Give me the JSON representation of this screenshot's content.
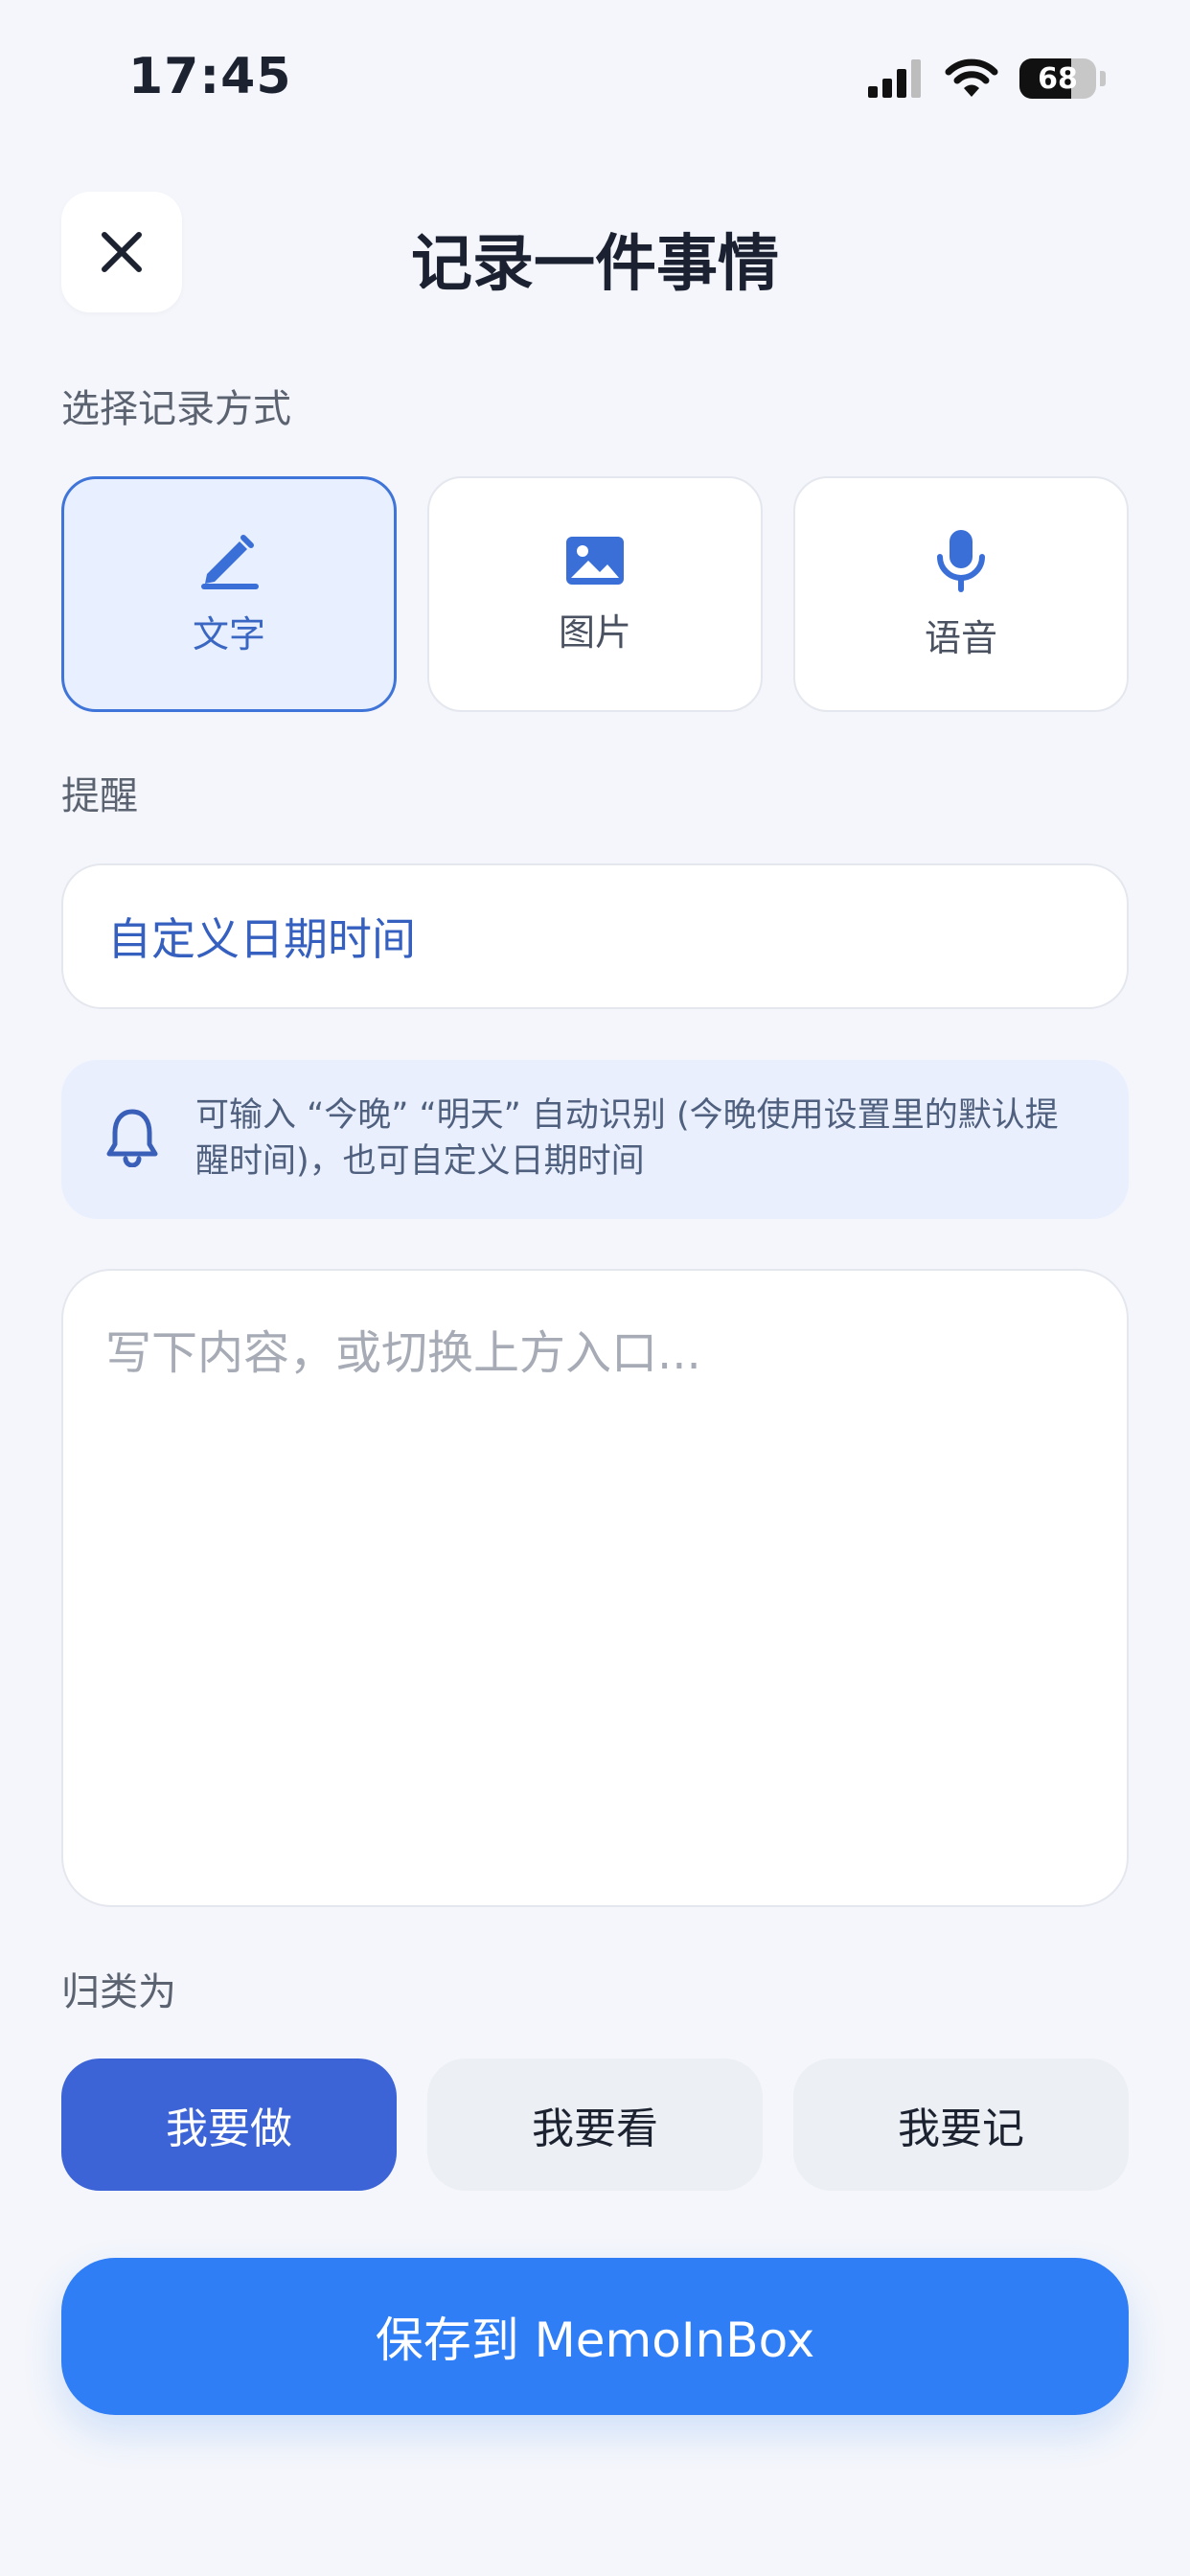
{
  "status_bar": {
    "time": "17:45",
    "battery_level": "68",
    "battery_fraction": 0.68
  },
  "header": {
    "title": "记录一件事情",
    "close_icon": "close-icon"
  },
  "mode_section": {
    "label": "选择记录方式",
    "options": [
      {
        "label": "文字",
        "icon": "pencil-icon",
        "selected": true
      },
      {
        "label": "图片",
        "icon": "image-icon",
        "selected": false
      },
      {
        "label": "语音",
        "icon": "microphone-icon",
        "selected": false
      }
    ]
  },
  "reminder": {
    "label": "提醒",
    "value": "自定义日期时间",
    "hint": "可输入 “今晚” “明天” 自动识别 (今晚使用设置里的默认提醒时间)，也可自定义日期时间",
    "hint_icon": "bell-icon"
  },
  "content": {
    "placeholder": "写下内容，或切换上方入口..."
  },
  "category": {
    "label": "归类为",
    "options": [
      {
        "label": "我要做",
        "selected": true
      },
      {
        "label": "我要看",
        "selected": false
      },
      {
        "label": "我要记",
        "selected": false
      }
    ]
  },
  "save_button": {
    "label": "保存到 MemoInBox"
  },
  "colors": {
    "accent": "#2f7ef6",
    "selected_category": "#3d64d6",
    "selected_mode_bg": "#e8efff",
    "background": "#f4f6fb"
  }
}
